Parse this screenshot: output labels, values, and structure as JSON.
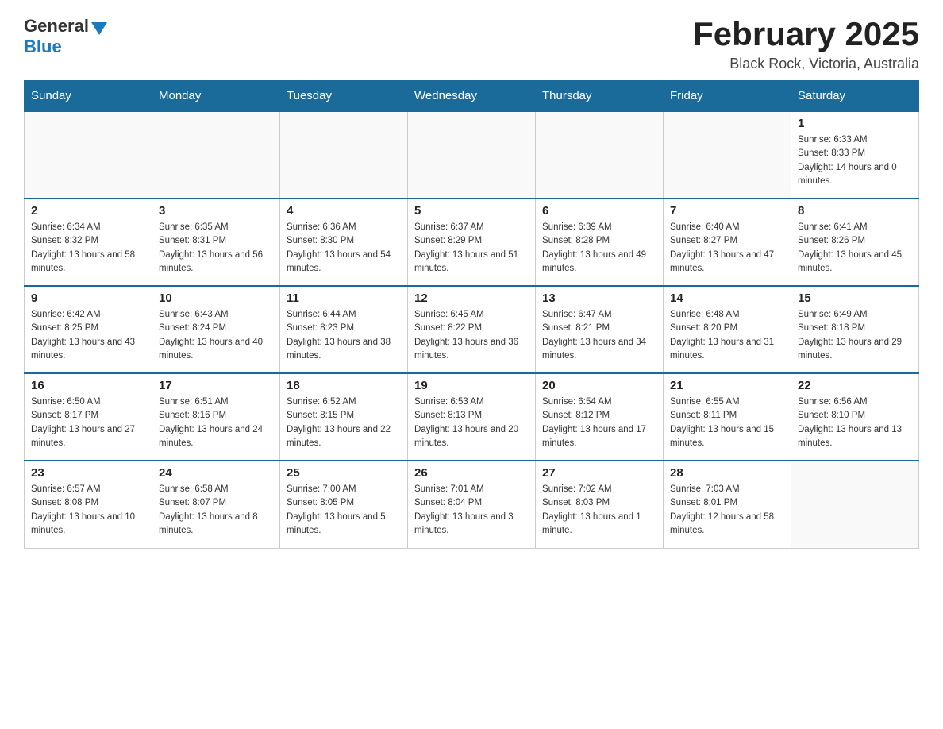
{
  "header": {
    "logo_general": "General",
    "logo_blue": "Blue",
    "month_title": "February 2025",
    "location": "Black Rock, Victoria, Australia"
  },
  "days_of_week": [
    "Sunday",
    "Monday",
    "Tuesday",
    "Wednesday",
    "Thursday",
    "Friday",
    "Saturday"
  ],
  "weeks": [
    [
      {
        "day": "",
        "sunrise": "",
        "sunset": "",
        "daylight": ""
      },
      {
        "day": "",
        "sunrise": "",
        "sunset": "",
        "daylight": ""
      },
      {
        "day": "",
        "sunrise": "",
        "sunset": "",
        "daylight": ""
      },
      {
        "day": "",
        "sunrise": "",
        "sunset": "",
        "daylight": ""
      },
      {
        "day": "",
        "sunrise": "",
        "sunset": "",
        "daylight": ""
      },
      {
        "day": "",
        "sunrise": "",
        "sunset": "",
        "daylight": ""
      },
      {
        "day": "1",
        "sunrise": "Sunrise: 6:33 AM",
        "sunset": "Sunset: 8:33 PM",
        "daylight": "Daylight: 14 hours and 0 minutes."
      }
    ],
    [
      {
        "day": "2",
        "sunrise": "Sunrise: 6:34 AM",
        "sunset": "Sunset: 8:32 PM",
        "daylight": "Daylight: 13 hours and 58 minutes."
      },
      {
        "day": "3",
        "sunrise": "Sunrise: 6:35 AM",
        "sunset": "Sunset: 8:31 PM",
        "daylight": "Daylight: 13 hours and 56 minutes."
      },
      {
        "day": "4",
        "sunrise": "Sunrise: 6:36 AM",
        "sunset": "Sunset: 8:30 PM",
        "daylight": "Daylight: 13 hours and 54 minutes."
      },
      {
        "day": "5",
        "sunrise": "Sunrise: 6:37 AM",
        "sunset": "Sunset: 8:29 PM",
        "daylight": "Daylight: 13 hours and 51 minutes."
      },
      {
        "day": "6",
        "sunrise": "Sunrise: 6:39 AM",
        "sunset": "Sunset: 8:28 PM",
        "daylight": "Daylight: 13 hours and 49 minutes."
      },
      {
        "day": "7",
        "sunrise": "Sunrise: 6:40 AM",
        "sunset": "Sunset: 8:27 PM",
        "daylight": "Daylight: 13 hours and 47 minutes."
      },
      {
        "day": "8",
        "sunrise": "Sunrise: 6:41 AM",
        "sunset": "Sunset: 8:26 PM",
        "daylight": "Daylight: 13 hours and 45 minutes."
      }
    ],
    [
      {
        "day": "9",
        "sunrise": "Sunrise: 6:42 AM",
        "sunset": "Sunset: 8:25 PM",
        "daylight": "Daylight: 13 hours and 43 minutes."
      },
      {
        "day": "10",
        "sunrise": "Sunrise: 6:43 AM",
        "sunset": "Sunset: 8:24 PM",
        "daylight": "Daylight: 13 hours and 40 minutes."
      },
      {
        "day": "11",
        "sunrise": "Sunrise: 6:44 AM",
        "sunset": "Sunset: 8:23 PM",
        "daylight": "Daylight: 13 hours and 38 minutes."
      },
      {
        "day": "12",
        "sunrise": "Sunrise: 6:45 AM",
        "sunset": "Sunset: 8:22 PM",
        "daylight": "Daylight: 13 hours and 36 minutes."
      },
      {
        "day": "13",
        "sunrise": "Sunrise: 6:47 AM",
        "sunset": "Sunset: 8:21 PM",
        "daylight": "Daylight: 13 hours and 34 minutes."
      },
      {
        "day": "14",
        "sunrise": "Sunrise: 6:48 AM",
        "sunset": "Sunset: 8:20 PM",
        "daylight": "Daylight: 13 hours and 31 minutes."
      },
      {
        "day": "15",
        "sunrise": "Sunrise: 6:49 AM",
        "sunset": "Sunset: 8:18 PM",
        "daylight": "Daylight: 13 hours and 29 minutes."
      }
    ],
    [
      {
        "day": "16",
        "sunrise": "Sunrise: 6:50 AM",
        "sunset": "Sunset: 8:17 PM",
        "daylight": "Daylight: 13 hours and 27 minutes."
      },
      {
        "day": "17",
        "sunrise": "Sunrise: 6:51 AM",
        "sunset": "Sunset: 8:16 PM",
        "daylight": "Daylight: 13 hours and 24 minutes."
      },
      {
        "day": "18",
        "sunrise": "Sunrise: 6:52 AM",
        "sunset": "Sunset: 8:15 PM",
        "daylight": "Daylight: 13 hours and 22 minutes."
      },
      {
        "day": "19",
        "sunrise": "Sunrise: 6:53 AM",
        "sunset": "Sunset: 8:13 PM",
        "daylight": "Daylight: 13 hours and 20 minutes."
      },
      {
        "day": "20",
        "sunrise": "Sunrise: 6:54 AM",
        "sunset": "Sunset: 8:12 PM",
        "daylight": "Daylight: 13 hours and 17 minutes."
      },
      {
        "day": "21",
        "sunrise": "Sunrise: 6:55 AM",
        "sunset": "Sunset: 8:11 PM",
        "daylight": "Daylight: 13 hours and 15 minutes."
      },
      {
        "day": "22",
        "sunrise": "Sunrise: 6:56 AM",
        "sunset": "Sunset: 8:10 PM",
        "daylight": "Daylight: 13 hours and 13 minutes."
      }
    ],
    [
      {
        "day": "23",
        "sunrise": "Sunrise: 6:57 AM",
        "sunset": "Sunset: 8:08 PM",
        "daylight": "Daylight: 13 hours and 10 minutes."
      },
      {
        "day": "24",
        "sunrise": "Sunrise: 6:58 AM",
        "sunset": "Sunset: 8:07 PM",
        "daylight": "Daylight: 13 hours and 8 minutes."
      },
      {
        "day": "25",
        "sunrise": "Sunrise: 7:00 AM",
        "sunset": "Sunset: 8:05 PM",
        "daylight": "Daylight: 13 hours and 5 minutes."
      },
      {
        "day": "26",
        "sunrise": "Sunrise: 7:01 AM",
        "sunset": "Sunset: 8:04 PM",
        "daylight": "Daylight: 13 hours and 3 minutes."
      },
      {
        "day": "27",
        "sunrise": "Sunrise: 7:02 AM",
        "sunset": "Sunset: 8:03 PM",
        "daylight": "Daylight: 13 hours and 1 minute."
      },
      {
        "day": "28",
        "sunrise": "Sunrise: 7:03 AM",
        "sunset": "Sunset: 8:01 PM",
        "daylight": "Daylight: 12 hours and 58 minutes."
      },
      {
        "day": "",
        "sunrise": "",
        "sunset": "",
        "daylight": ""
      }
    ]
  ]
}
